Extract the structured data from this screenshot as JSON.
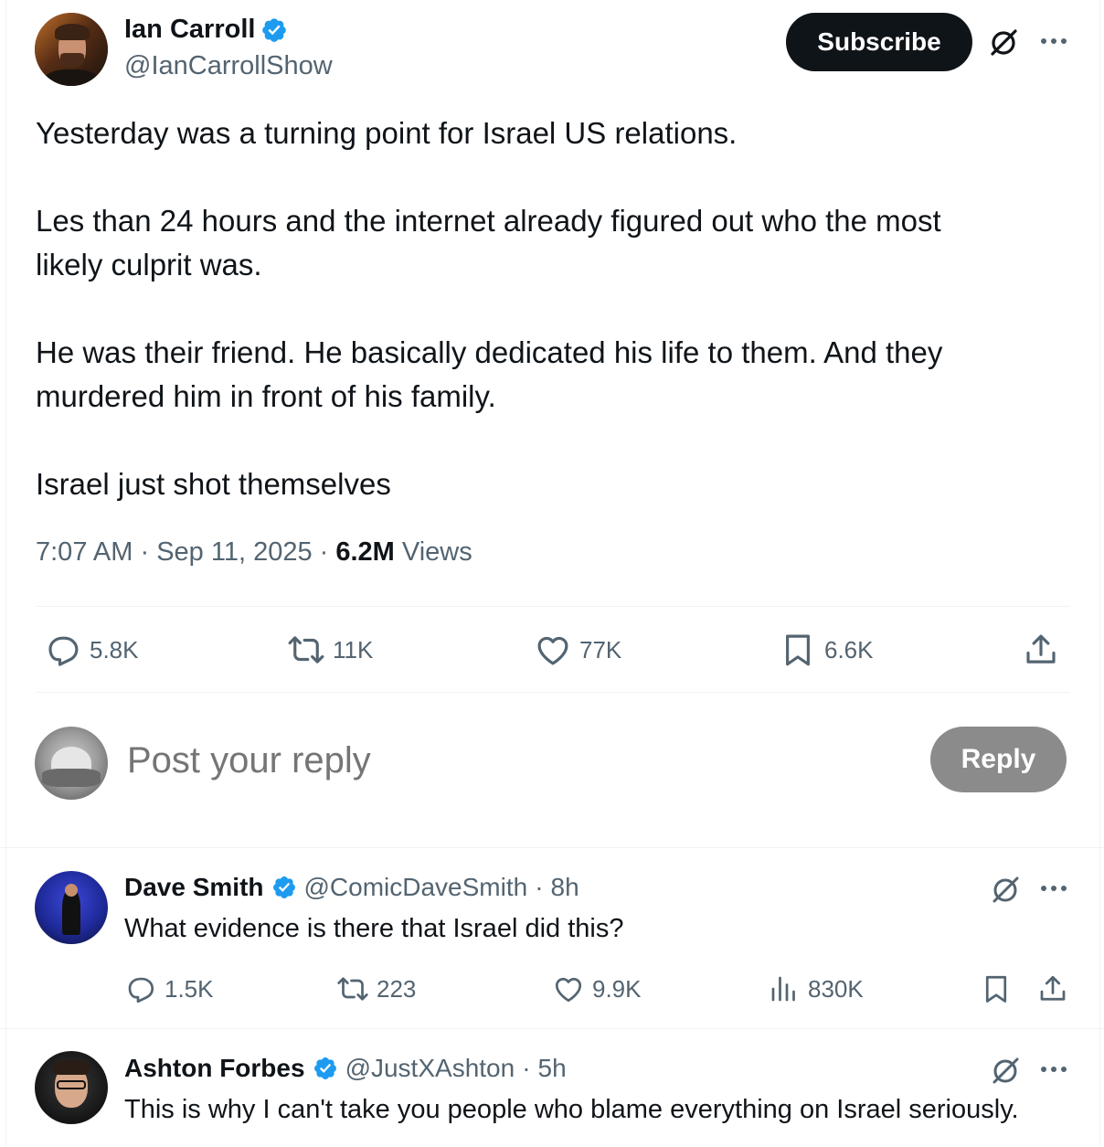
{
  "post": {
    "author_name": "Ian Carroll",
    "author_handle": "@IanCarrollShow",
    "subscribe_label": "Subscribe",
    "text_lines": [
      "Yesterday was a turning point for Israel US relations.",
      "",
      "Les than 24 hours and the internet already figured out who the most",
      "likely culprit was.",
      "",
      "He was their friend. He basically dedicated his life to them. And they",
      "murdered him in front of his family.",
      "",
      "Israel just shot themselves"
    ],
    "time": "7:07 AM",
    "date": "Sep 11, 2025",
    "views_count": "6.2M",
    "views_label": "Views",
    "actions": {
      "replies": "5.8K",
      "reposts": "11K",
      "likes": "77K",
      "bookmarks": "6.6K"
    }
  },
  "composer": {
    "placeholder": "Post your reply",
    "reply_label": "Reply"
  },
  "replies": [
    {
      "name": "Dave Smith",
      "handle": "@ComicDaveSmith",
      "age": "8h",
      "text": "What evidence is there that Israel did this?",
      "actions": {
        "replies": "1.5K",
        "reposts": "223",
        "likes": "9.9K",
        "views": "830K"
      }
    },
    {
      "name": "Ashton Forbes",
      "handle": "@JustXAshton",
      "age": "5h",
      "text": "This is why I can't take you people who blame everything on Israel seriously."
    }
  ],
  "colors": {
    "text": "#0f1419",
    "secondary": "#536471",
    "verified": "#1d9bf0",
    "divider": "#eff3f4",
    "reply_button": "#8b8b8b"
  },
  "icons": [
    "verified-badge-icon",
    "grok-icon",
    "more-icon",
    "reply-icon",
    "repost-icon",
    "like-icon",
    "bookmark-icon",
    "share-icon",
    "views-icon"
  ]
}
